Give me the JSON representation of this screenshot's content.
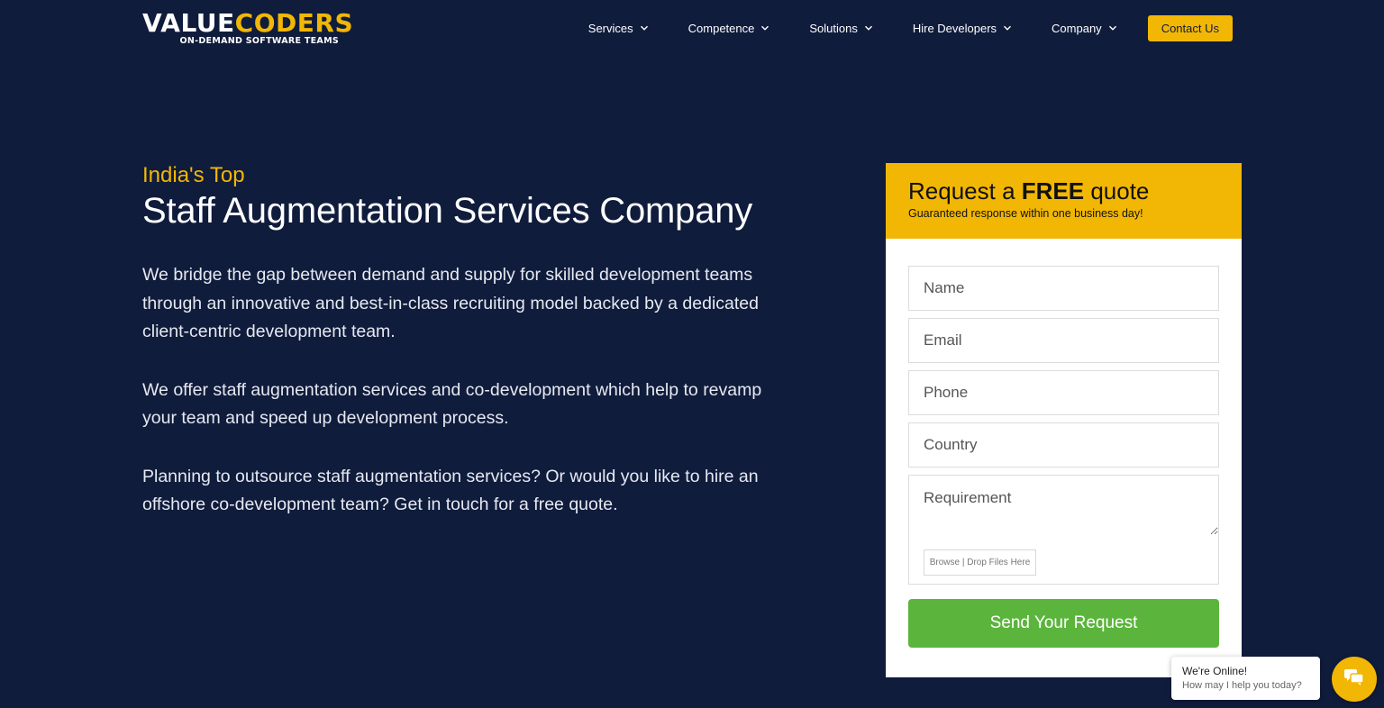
{
  "header": {
    "logo": {
      "part1": "VALUE",
      "part2": "CODERS",
      "tagline": "ON-DEMAND SOFTWARE TEAMS"
    },
    "nav": [
      {
        "label": "Services"
      },
      {
        "label": "Competence"
      },
      {
        "label": "Solutions"
      },
      {
        "label": "Hire Developers"
      },
      {
        "label": "Company"
      }
    ],
    "contact_label": "Contact Us"
  },
  "hero": {
    "kicker": "India's Top",
    "title": "Staff Augmentation Services Company",
    "paragraphs": [
      "We bridge the gap between demand and supply for skilled development teams through an innovative and best-in-class recruiting model backed by a dedicated client-centric development team.",
      "We offer staff augmentation services and co-development which help to revamp your team and speed up development process.",
      "Planning to outsource staff augmentation services? Or would you like to hire an offshore co-development team? Get in touch for a free quote."
    ]
  },
  "form": {
    "title_pre": "Request a ",
    "title_bold": "FREE",
    "title_post": " quote",
    "subtitle": "Guaranteed response within one business day!",
    "fields": {
      "name": "Name",
      "email": "Email",
      "phone": "Phone",
      "country": "Country",
      "requirement": "Requirement"
    },
    "file_label": "Browse | Drop Files Here",
    "submit_label": "Send Your Request"
  },
  "chat": {
    "title": "We're Online!",
    "subtitle": "How may I help you today?"
  },
  "colors": {
    "background": "#101c3c",
    "accent": "#f2b705",
    "submit": "#5bb53c"
  }
}
